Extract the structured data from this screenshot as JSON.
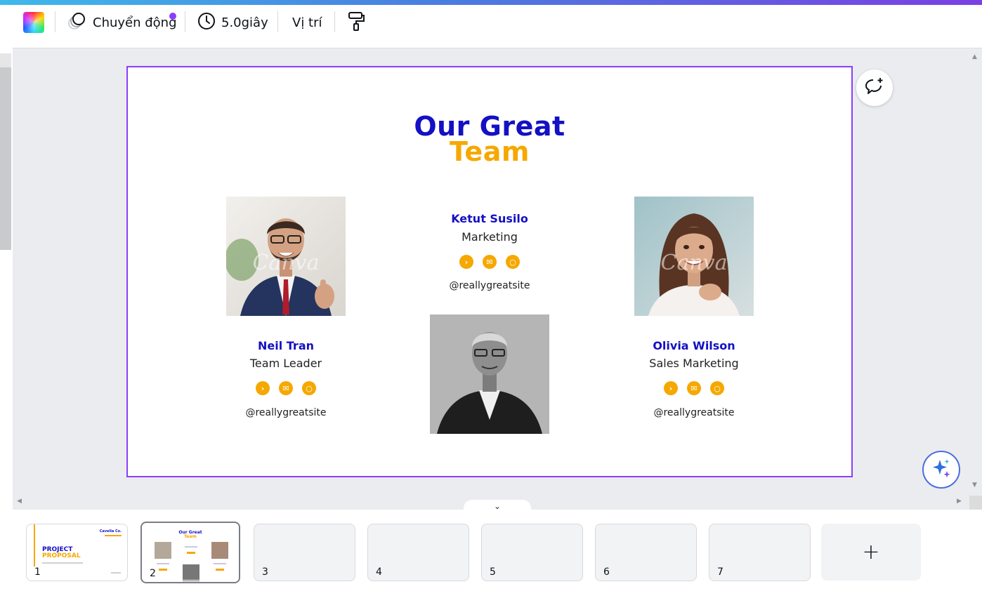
{
  "toolbar": {
    "animate_label": "Chuyển động",
    "duration_label": "5.0giây",
    "position_label": "Vị trí"
  },
  "slide": {
    "title_line1": "Our Great",
    "title_line2": "Team",
    "photo_watermark": "Canva",
    "members": [
      {
        "name": "Neil Tran",
        "role": "Team Leader",
        "handle": "@reallygreatsite"
      },
      {
        "name": "Ketut Susilo",
        "role": "Marketing",
        "handle": "@reallygreatsite"
      },
      {
        "name": "Olivia Wilson",
        "role": "Sales Marketing",
        "handle": "@reallygreatsite"
      }
    ],
    "accent_blue": "#1410c4",
    "accent_yellow": "#f5a800"
  },
  "pages": {
    "thumbs": [
      {
        "number": "1",
        "title_line1": "PROJECT",
        "title_line2": "PROPOSAL",
        "brand": "Cavella Co."
      },
      {
        "number": "2",
        "title_line1": "Our Great",
        "title_line2": "Team"
      },
      {
        "number": "3"
      },
      {
        "number": "4"
      },
      {
        "number": "5"
      },
      {
        "number": "6"
      },
      {
        "number": "7"
      }
    ],
    "add_label": "+"
  },
  "selection_color": "#8b3dff"
}
